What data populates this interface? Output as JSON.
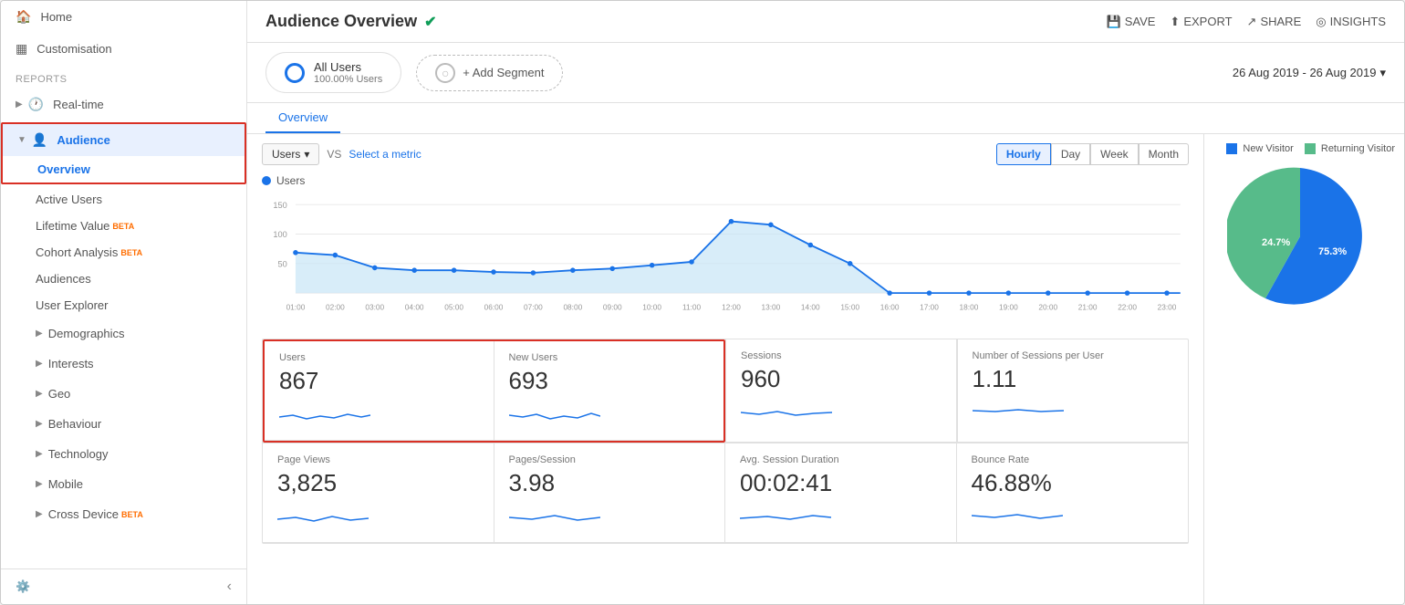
{
  "sidebar": {
    "home_label": "Home",
    "customisation_label": "Customisation",
    "reports_label": "REPORTS",
    "realtime_label": "Real-time",
    "audience_label": "Audience",
    "overview_label": "Overview",
    "active_users_label": "Active Users",
    "lifetime_value_label": "Lifetime Value",
    "cohort_analysis_label": "Cohort Analysis",
    "audiences_label": "Audiences",
    "user_explorer_label": "User Explorer",
    "demographics_label": "Demographics",
    "interests_label": "Interests",
    "geo_label": "Geo",
    "behaviour_label": "Behaviour",
    "technology_label": "Technology",
    "mobile_label": "Mobile",
    "cross_device_label": "Cross Device"
  },
  "header": {
    "title": "Audience Overview",
    "save_label": "SAVE",
    "export_label": "EXPORT",
    "share_label": "SHARE",
    "insights_label": "INSIGHTS"
  },
  "segment": {
    "all_users_label": "All Users",
    "all_users_sub": "100.00% Users",
    "add_segment_label": "+ Add Segment",
    "date_range": "26 Aug 2019 - 26 Aug 2019"
  },
  "tabs": {
    "overview_label": "Overview"
  },
  "chart": {
    "users_legend": "Users",
    "metric_btn": "Users",
    "vs_label": "VS",
    "select_metric": "Select a metric",
    "hourly_label": "Hourly",
    "day_label": "Day",
    "week_label": "Week",
    "month_label": "Month",
    "new_visitor_label": "New Visitor",
    "returning_visitor_label": "Returning Visitor",
    "y_labels": [
      "150",
      "100",
      "50"
    ],
    "x_labels": [
      "01:00",
      "02:00",
      "03:00",
      "04:00",
      "05:00",
      "06:00",
      "07:00",
      "08:00",
      "09:00",
      "10:00",
      "11:00",
      "12:00",
      "13:00",
      "14:00",
      "15:00",
      "16:00",
      "17:00",
      "18:00",
      "19:00",
      "20:00",
      "21:00",
      "22:00",
      "23:00"
    ]
  },
  "stats": {
    "row1": [
      {
        "label": "Users",
        "value": "867",
        "highlighted": true
      },
      {
        "label": "New Users",
        "value": "693",
        "highlighted": true
      },
      {
        "label": "Sessions",
        "value": "960",
        "highlighted": false
      },
      {
        "label": "Number of Sessions per User",
        "value": "1.11",
        "highlighted": false
      }
    ],
    "row2": [
      {
        "label": "Page Views",
        "value": "3,825",
        "highlighted": false
      },
      {
        "label": "Pages/Session",
        "value": "3.98",
        "highlighted": false
      },
      {
        "label": "Avg. Session Duration",
        "value": "00:02:41",
        "highlighted": false
      },
      {
        "label": "Bounce Rate",
        "value": "46.88%",
        "highlighted": false
      }
    ]
  },
  "pie": {
    "new_visitor_pct": "75.3%",
    "returning_visitor_pct": "24.7%",
    "new_visitor_color": "#1a73e8",
    "returning_visitor_color": "#57bb8a"
  },
  "colors": {
    "accent": "#1a73e8",
    "danger": "#d93025",
    "green": "#57bb8a",
    "light_blue_fill": "#c8e6f7"
  }
}
